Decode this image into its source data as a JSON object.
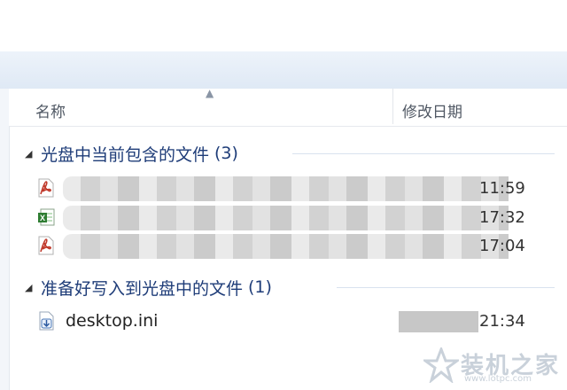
{
  "columns": {
    "name": "名称",
    "date_modified": "修改日期"
  },
  "groups": [
    {
      "title": "光盘中当前包含的文件",
      "count": "(3)",
      "files": [
        {
          "icon": "pdf-icon",
          "time": "11:59"
        },
        {
          "icon": "excel-icon",
          "time": "17:32"
        },
        {
          "icon": "pdf-icon",
          "time": "17:04"
        }
      ]
    },
    {
      "title": "准备好写入到光盘中的文件",
      "count": "(1)",
      "files": [
        {
          "icon": "ini-file-icon",
          "name": "desktop.ini",
          "time": "21:34"
        }
      ]
    }
  ],
  "watermark": {
    "text": "装机之家",
    "url": "www.lotpc.com"
  },
  "colors": {
    "group_title": "#1e3c78",
    "ribbon": "#dfe9f5",
    "pdf": "#c0392b",
    "excel": "#2e7d32"
  }
}
